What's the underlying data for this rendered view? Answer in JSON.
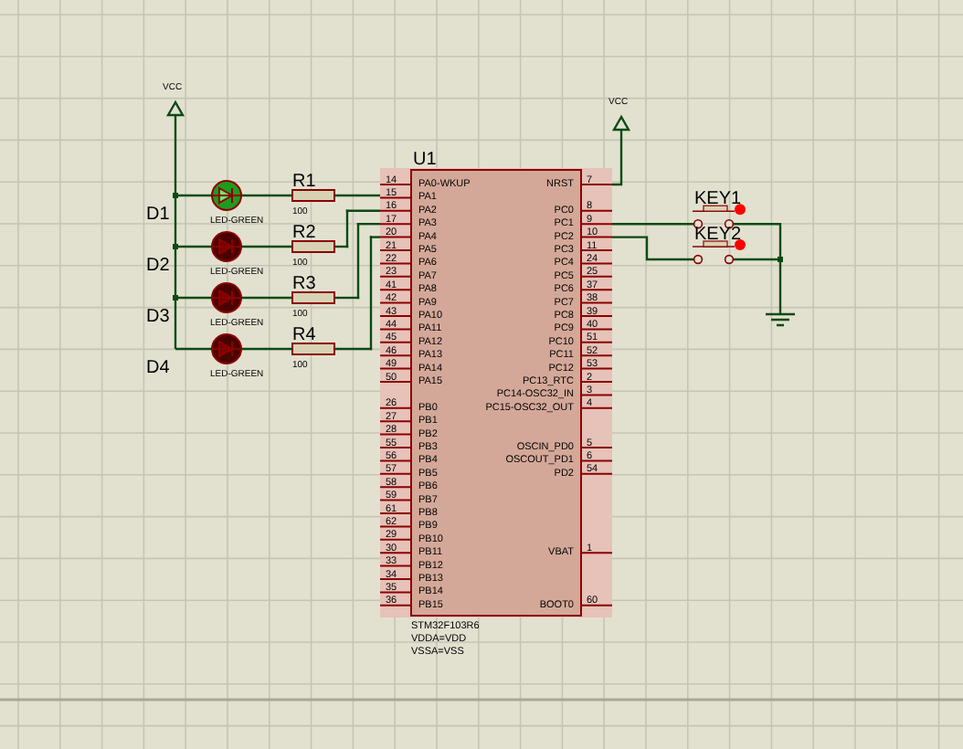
{
  "schematic": {
    "power": [
      {
        "label": "VCC"
      },
      {
        "label": "VCC"
      }
    ],
    "leds": [
      {
        "ref": "D1",
        "value": "LED-GREEN",
        "on": true
      },
      {
        "ref": "D2",
        "value": "LED-GREEN",
        "on": false
      },
      {
        "ref": "D3",
        "value": "LED-GREEN",
        "on": false
      },
      {
        "ref": "D4",
        "value": "LED-GREEN",
        "on": false
      }
    ],
    "resistors": [
      {
        "ref": "R1",
        "value": "100"
      },
      {
        "ref": "R2",
        "value": "100"
      },
      {
        "ref": "R3",
        "value": "100"
      },
      {
        "ref": "R4",
        "value": "100"
      }
    ],
    "chip": {
      "ref": "U1",
      "left_pin_groups": [
        [
          {
            "number": "14",
            "name": "PA0-WKUP"
          },
          {
            "number": "15",
            "name": "PA1"
          },
          {
            "number": "16",
            "name": "PA2"
          },
          {
            "number": "17",
            "name": "PA3"
          },
          {
            "number": "20",
            "name": "PA4"
          },
          {
            "number": "21",
            "name": "PA5"
          },
          {
            "number": "22",
            "name": "PA6"
          },
          {
            "number": "23",
            "name": "PA7"
          },
          {
            "number": "41",
            "name": "PA8"
          },
          {
            "number": "42",
            "name": "PA9"
          },
          {
            "number": "43",
            "name": "PA10"
          },
          {
            "number": "44",
            "name": "PA11"
          },
          {
            "number": "45",
            "name": "PA12"
          },
          {
            "number": "46",
            "name": "PA13"
          },
          {
            "number": "49",
            "name": "PA14"
          },
          {
            "number": "50",
            "name": "PA15"
          }
        ],
        [
          {
            "number": "26",
            "name": "PB0"
          },
          {
            "number": "27",
            "name": "PB1"
          },
          {
            "number": "28",
            "name": "PB2"
          },
          {
            "number": "55",
            "name": "PB3"
          },
          {
            "number": "56",
            "name": "PB4"
          },
          {
            "number": "57",
            "name": "PB5"
          },
          {
            "number": "58",
            "name": "PB6"
          },
          {
            "number": "59",
            "name": "PB7"
          },
          {
            "number": "61",
            "name": "PB8"
          },
          {
            "number": "62",
            "name": "PB9"
          },
          {
            "number": "29",
            "name": "PB10"
          },
          {
            "number": "30",
            "name": "PB11"
          },
          {
            "number": "33",
            "name": "PB12"
          },
          {
            "number": "34",
            "name": "PB13"
          },
          {
            "number": "35",
            "name": "PB14"
          },
          {
            "number": "36",
            "name": "PB15"
          }
        ]
      ],
      "right_pin_groups": [
        [
          {
            "number": "7",
            "name": "NRST"
          }
        ],
        [
          {
            "number": "8",
            "name": "PC0"
          },
          {
            "number": "9",
            "name": "PC1"
          },
          {
            "number": "10",
            "name": "PC2"
          },
          {
            "number": "11",
            "name": "PC3"
          },
          {
            "number": "24",
            "name": "PC4"
          },
          {
            "number": "25",
            "name": "PC5"
          },
          {
            "number": "37",
            "name": "PC6"
          },
          {
            "number": "38",
            "name": "PC7"
          },
          {
            "number": "39",
            "name": "PC8"
          },
          {
            "number": "40",
            "name": "PC9"
          },
          {
            "number": "51",
            "name": "PC10"
          },
          {
            "number": "52",
            "name": "PC11"
          },
          {
            "number": "53",
            "name": "PC12"
          },
          {
            "number": "2",
            "name": "PC13_RTC"
          },
          {
            "number": "3",
            "name": "PC14-OSC32_IN"
          },
          {
            "number": "4",
            "name": "PC15-OSC32_OUT"
          }
        ],
        [
          {
            "number": "5",
            "name": "OSCIN_PD0"
          },
          {
            "number": "6",
            "name": "OSCOUT_PD1"
          },
          {
            "number": "54",
            "name": "PD2"
          }
        ],
        [
          {
            "number": "1",
            "name": "VBAT"
          }
        ],
        [
          {
            "number": "60",
            "name": "BOOT0"
          }
        ]
      ],
      "notes": [
        "STM32F103R6",
        "VDDA=VDD",
        "VSSA=VSS"
      ]
    },
    "keys": [
      {
        "ref": "KEY1"
      },
      {
        "ref": "KEY2"
      }
    ]
  }
}
